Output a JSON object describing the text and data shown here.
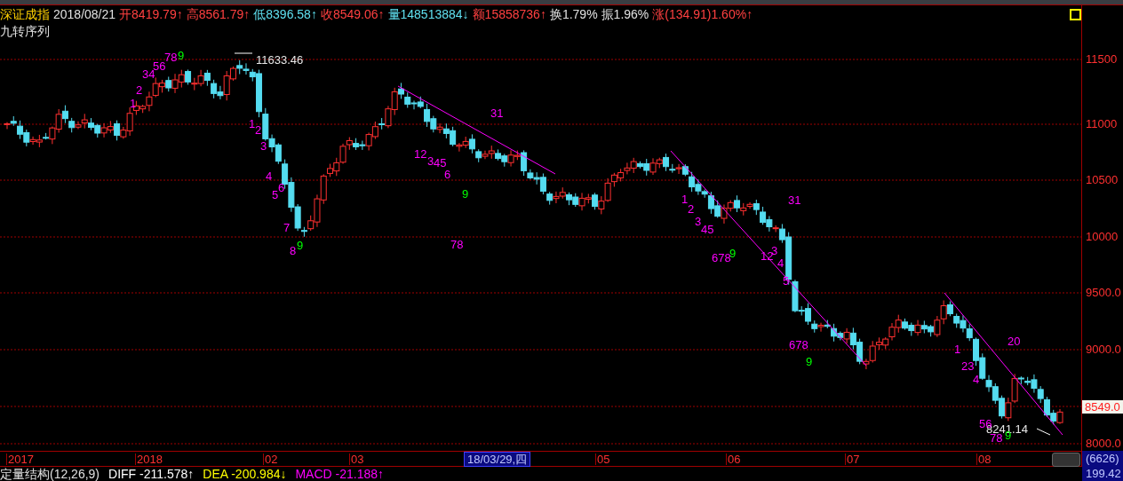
{
  "header": {
    "title": "深证成指",
    "date": "2018/08/21",
    "fields": [
      {
        "text": "开8419.79↑",
        "color": "#ff4040"
      },
      {
        "text": "高8561.79↑",
        "color": "#ff4040"
      },
      {
        "text": "低8396.58↑",
        "color": "#5fe0f0"
      },
      {
        "text": "收8549.06↑",
        "color": "#ff4040"
      },
      {
        "text": "量148513884↓",
        "color": "#5fe0f0"
      },
      {
        "text": "额15858736↑",
        "color": "#ff4040"
      },
      {
        "text": "换1.79%",
        "color": "#e0e0e0"
      },
      {
        "text": "振1.96%",
        "color": "#e0e0e0"
      },
      {
        "text": "涨(134.91)1.60%↑",
        "color": "#ff4040"
      }
    ]
  },
  "chart": {
    "indicator_name": "九转序列",
    "price_labels": [
      "11633.46",
      "8241.14"
    ],
    "sequence_marks": [
      {
        "text": "1",
        "color": "#ff00ff"
      },
      {
        "text": "2",
        "color": "#ff00ff"
      },
      {
        "text": "34",
        "color": "#ff00ff"
      },
      {
        "text": "56",
        "color": "#ff00ff"
      },
      {
        "text": "78",
        "color": "#ff00ff"
      },
      {
        "text": "9",
        "color": "#00ff00"
      },
      {
        "text": "1",
        "color": "#ff00ff"
      },
      {
        "text": "2",
        "color": "#ff00ff"
      },
      {
        "text": "3",
        "color": "#ff00ff"
      },
      {
        "text": "4",
        "color": "#ff00ff"
      },
      {
        "text": "5",
        "color": "#ff00ff"
      },
      {
        "text": "6",
        "color": "#ff00ff"
      },
      {
        "text": "7",
        "color": "#ff00ff"
      },
      {
        "text": "8",
        "color": "#ff00ff"
      },
      {
        "text": "9",
        "color": "#00ff00"
      },
      {
        "text": "12",
        "color": "#ff00ff"
      },
      {
        "text": "3",
        "color": "#ff00ff"
      },
      {
        "text": "45",
        "color": "#ff00ff"
      },
      {
        "text": "6",
        "color": "#ff00ff"
      },
      {
        "text": "78",
        "color": "#ff00ff"
      },
      {
        "text": "9",
        "color": "#00ff00"
      },
      {
        "text": "31",
        "color": "#ff00ff"
      },
      {
        "text": "1",
        "color": "#ff00ff"
      },
      {
        "text": "2",
        "color": "#ff00ff"
      },
      {
        "text": "3",
        "color": "#ff00ff"
      },
      {
        "text": "45",
        "color": "#ff00ff"
      },
      {
        "text": "678",
        "color": "#ff00ff"
      },
      {
        "text": "9",
        "color": "#00ff00"
      },
      {
        "text": "12",
        "color": "#ff00ff"
      },
      {
        "text": "3",
        "color": "#ff00ff"
      },
      {
        "text": "4",
        "color": "#ff00ff"
      },
      {
        "text": "5",
        "color": "#ff00ff"
      },
      {
        "text": "31",
        "color": "#ff00ff"
      },
      {
        "text": "678",
        "color": "#ff00ff"
      },
      {
        "text": "9",
        "color": "#00ff00"
      },
      {
        "text": "1",
        "color": "#ff00ff"
      },
      {
        "text": "23",
        "color": "#ff00ff"
      },
      {
        "text": "4",
        "color": "#ff00ff"
      },
      {
        "text": "56",
        "color": "#ff00ff"
      },
      {
        "text": "78",
        "color": "#ff00ff"
      },
      {
        "text": "9",
        "color": "#00ff00"
      },
      {
        "text": "20",
        "color": "#ff00ff"
      }
    ]
  },
  "price_axis": {
    "ticks": [
      "11500",
      "11000",
      "10500",
      "10000",
      "9500.0",
      "9000.0",
      "8000.0"
    ],
    "current_price": "8549.0"
  },
  "time_axis": {
    "labels": [
      "2017",
      "2018",
      "02",
      "03",
      "05",
      "06",
      "07",
      "08"
    ],
    "cursor_date": "18/03/29,四",
    "count": "(6626)"
  },
  "indicator": {
    "name": "定量结构(12,26,9)",
    "values": [
      {
        "text": "DIFF -211.578↑",
        "color": "#ffffff"
      },
      {
        "text": "DEA -200.984↓",
        "color": "#ffff00"
      },
      {
        "text": "MACD -21.188↑",
        "color": "#ff00ff"
      }
    ],
    "scale_value": "199.42"
  }
}
